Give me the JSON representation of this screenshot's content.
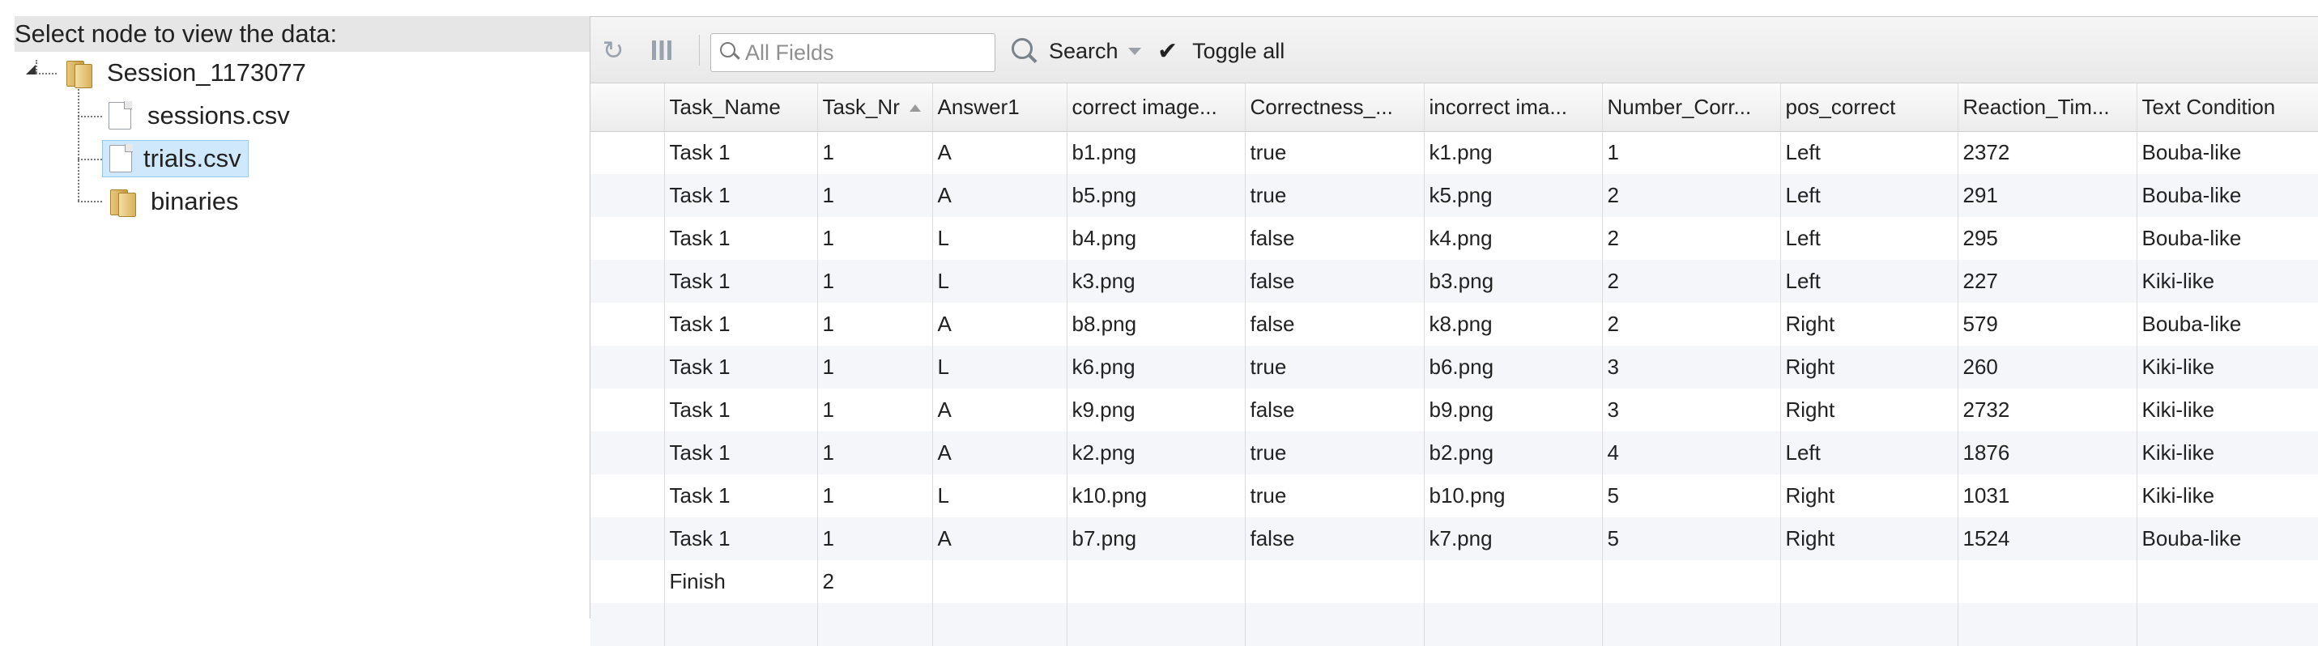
{
  "tree": {
    "header": "Select node to view the data:",
    "root_label": "Session_1173077",
    "children": [
      {
        "label": "sessions.csv",
        "type": "file",
        "selected": false
      },
      {
        "label": "trials.csv",
        "type": "file",
        "selected": true
      },
      {
        "label": "binaries",
        "type": "folder",
        "selected": false
      }
    ]
  },
  "toolbar": {
    "refresh_icon": "refresh-icon",
    "columns_icon": "columns-icon",
    "search_placeholder": "All Fields",
    "search_label": "Search",
    "toggle_all_label": "Toggle all"
  },
  "grid": {
    "columns": [
      "",
      "Task_Name",
      "Task_Nr",
      "Answer1",
      "correct image...",
      "Correctness_...",
      "incorrect ima...",
      "Number_Corr...",
      "pos_correct",
      "Reaction_Tim...",
      "Text Condition"
    ],
    "sorted_column": "Task_Nr",
    "sort_direction": "ascending",
    "rows": [
      [
        "",
        "Task 1",
        "1",
        "A",
        "b1.png",
        "true",
        "k1.png",
        "1",
        "Left",
        "2372",
        "Bouba-like"
      ],
      [
        "",
        "Task 1",
        "1",
        "A",
        "b5.png",
        "true",
        "k5.png",
        "2",
        "Left",
        "291",
        "Bouba-like"
      ],
      [
        "",
        "Task 1",
        "1",
        "L",
        "b4.png",
        "false",
        "k4.png",
        "2",
        "Left",
        "295",
        "Bouba-like"
      ],
      [
        "",
        "Task 1",
        "1",
        "L",
        "k3.png",
        "false",
        "b3.png",
        "2",
        "Left",
        "227",
        "Kiki-like"
      ],
      [
        "",
        "Task 1",
        "1",
        "A",
        "b8.png",
        "false",
        "k8.png",
        "2",
        "Right",
        "579",
        "Bouba-like"
      ],
      [
        "",
        "Task 1",
        "1",
        "L",
        "k6.png",
        "true",
        "b6.png",
        "3",
        "Right",
        "260",
        "Kiki-like"
      ],
      [
        "",
        "Task 1",
        "1",
        "A",
        "k9.png",
        "false",
        "b9.png",
        "3",
        "Right",
        "2732",
        "Kiki-like"
      ],
      [
        "",
        "Task 1",
        "1",
        "A",
        "k2.png",
        "true",
        "b2.png",
        "4",
        "Left",
        "1876",
        "Kiki-like"
      ],
      [
        "",
        "Task 1",
        "1",
        "L",
        "k10.png",
        "true",
        "b10.png",
        "5",
        "Right",
        "1031",
        "Kiki-like"
      ],
      [
        "",
        "Task 1",
        "1",
        "A",
        "b7.png",
        "false",
        "k7.png",
        "5",
        "Right",
        "1524",
        "Bouba-like"
      ],
      [
        "",
        "Finish",
        "2",
        "",
        "",
        "",
        "",
        "",
        "",
        "",
        ""
      ],
      [
        "",
        "",
        "",
        "",
        "",
        "",
        "",
        "",
        "",
        "",
        ""
      ]
    ]
  },
  "colors": {
    "selected_node": "#cfe8fc",
    "row_stripe": "#f4f6f9",
    "header_bg": "#e6e6e6"
  }
}
